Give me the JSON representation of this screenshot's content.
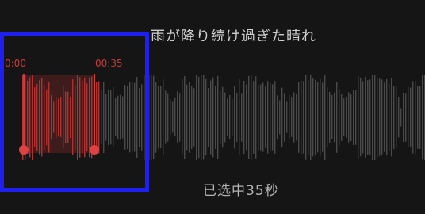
{
  "lyric": {
    "text": "雨が降り続け過ぎた晴れ"
  },
  "selection": {
    "start_time": "0:00",
    "end_time": "00:35",
    "selected_text": "已选中35秒",
    "selected_fraction": 0.24
  },
  "colors": {
    "background": "#151515",
    "wave": "#6a6a6a",
    "selection": "#d13b3b",
    "highlight_frame": "#1f1ff0"
  }
}
